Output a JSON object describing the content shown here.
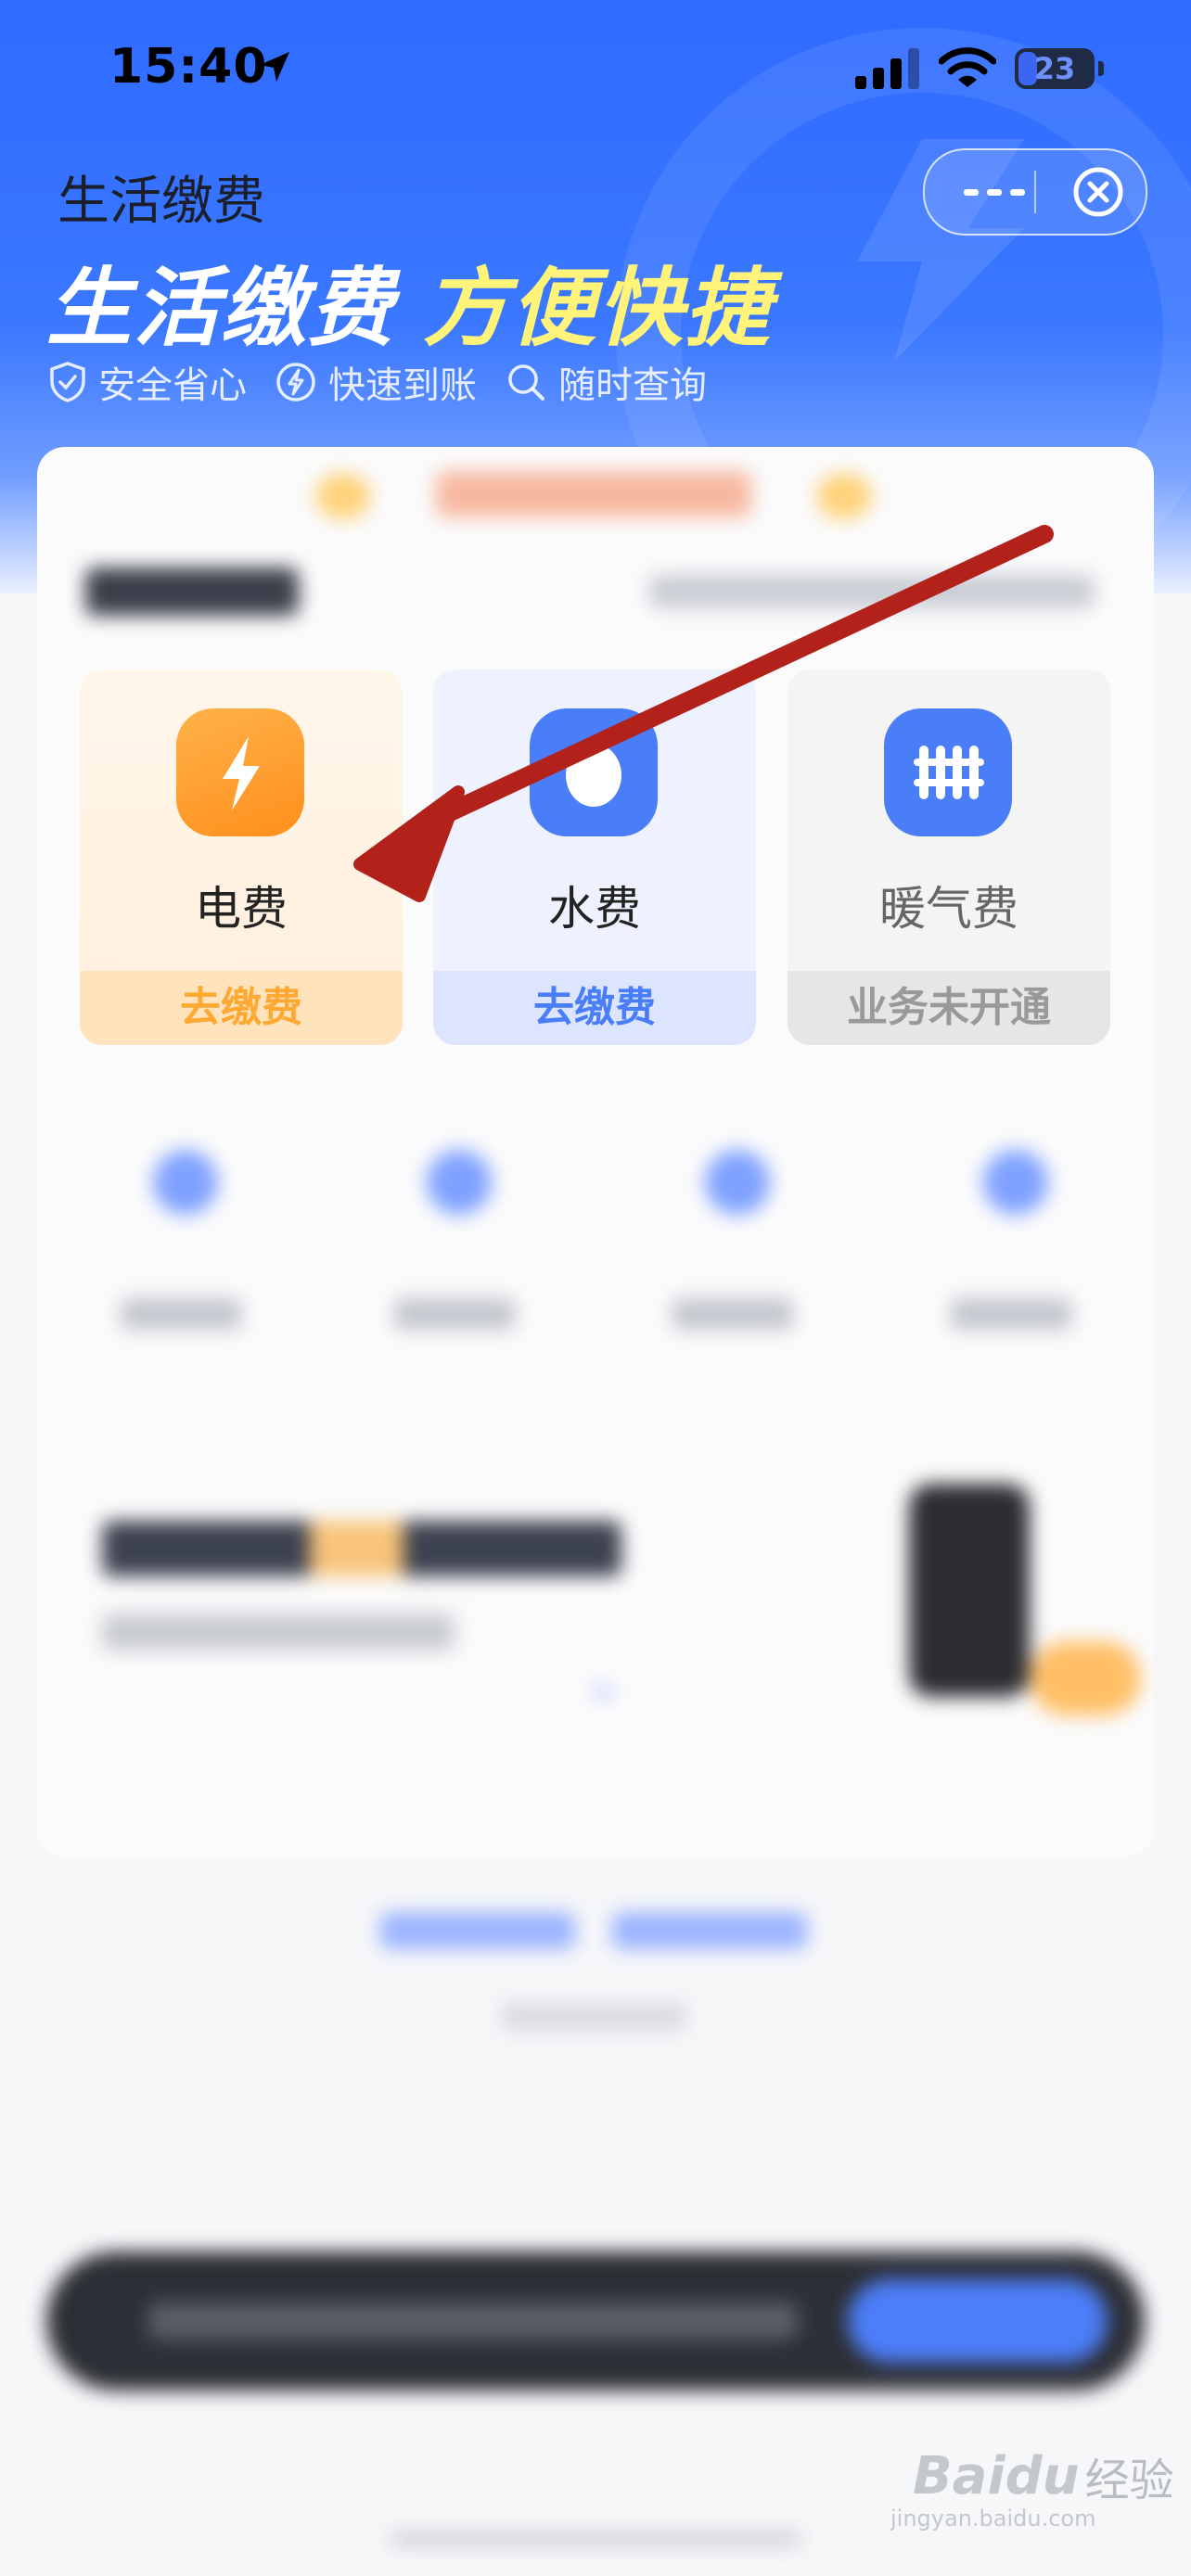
{
  "status_bar": {
    "time": "15:40",
    "battery": "23"
  },
  "header": {
    "title": "生活缴费",
    "slogan_a": "生活缴费",
    "slogan_b": "方便快捷",
    "features": [
      "安全省心",
      "快速到账",
      "随时查询"
    ]
  },
  "services": [
    {
      "name": "电费",
      "action": "去缴费",
      "icon": "lightning-icon"
    },
    {
      "name": "水费",
      "action": "去缴费",
      "icon": "water-drop-icon"
    },
    {
      "name": "暖气费",
      "action": "业务未开通",
      "icon": "radiator-icon"
    }
  ],
  "watermark": {
    "brand": "Baidu",
    "suffix": "经验",
    "url": "jingyan.baidu.com"
  },
  "colors": {
    "header_blue": "#2f6bff",
    "electric_orange": "#ff9a26",
    "water_blue": "#4a7ef8",
    "slogan_yellow": "#fff37a",
    "annotation_arrow": "#b3211b"
  }
}
